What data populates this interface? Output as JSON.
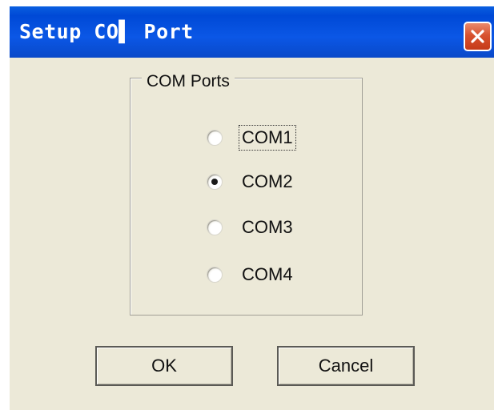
{
  "window": {
    "title": "Setup CO▌ Port"
  },
  "group": {
    "legend": "COM Ports",
    "options": [
      {
        "label": "COM1",
        "selected": false,
        "focused": true
      },
      {
        "label": "COM2",
        "selected": true,
        "focused": false
      },
      {
        "label": "COM3",
        "selected": false,
        "focused": false
      },
      {
        "label": "COM4",
        "selected": false,
        "focused": false
      }
    ]
  },
  "buttons": {
    "ok_label": "OK",
    "cancel_label": "Cancel"
  },
  "icons": {
    "close": "close-icon"
  },
  "colors": {
    "titlebar": "#0b57e6",
    "dialog_bg": "#ece9d8",
    "close_button": "#d8522f"
  }
}
